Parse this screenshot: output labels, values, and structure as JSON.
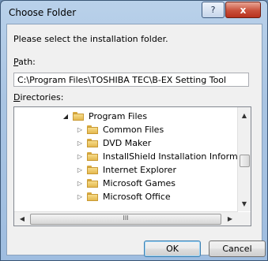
{
  "window": {
    "title": "Choose Folder",
    "help_icon": "?",
    "close_icon": "x"
  },
  "prompt": "Please select the installation folder.",
  "path": {
    "label_key": "P",
    "label_rest": "ath:",
    "value": "C:\\Program Files\\TOSHIBA TEC\\B-EX Setting Tool"
  },
  "directories": {
    "label_key": "D",
    "label_rest": "irectories:",
    "items": [
      {
        "label": "Program Files",
        "state": "expanded",
        "level": 0
      },
      {
        "label": "Common Files",
        "state": "collapsed",
        "level": 1
      },
      {
        "label": "DVD Maker",
        "state": "collapsed",
        "level": 1
      },
      {
        "label": "InstallShield Installation Information",
        "state": "collapsed",
        "level": 1
      },
      {
        "label": "Internet Explorer",
        "state": "collapsed",
        "level": 1
      },
      {
        "label": "Microsoft Games",
        "state": "collapsed",
        "level": 1
      },
      {
        "label": "Microsoft Office",
        "state": "collapsed",
        "level": 1
      }
    ]
  },
  "scrollbars": {
    "hscroll_grip": "III"
  },
  "buttons": {
    "ok": "OK",
    "cancel": "Cancel"
  },
  "colors": {
    "titlebar": "#a9c4e2",
    "close_button": "#c9503b",
    "dialog_bg": "#f0f0f0",
    "folder": "#e4b94f"
  }
}
